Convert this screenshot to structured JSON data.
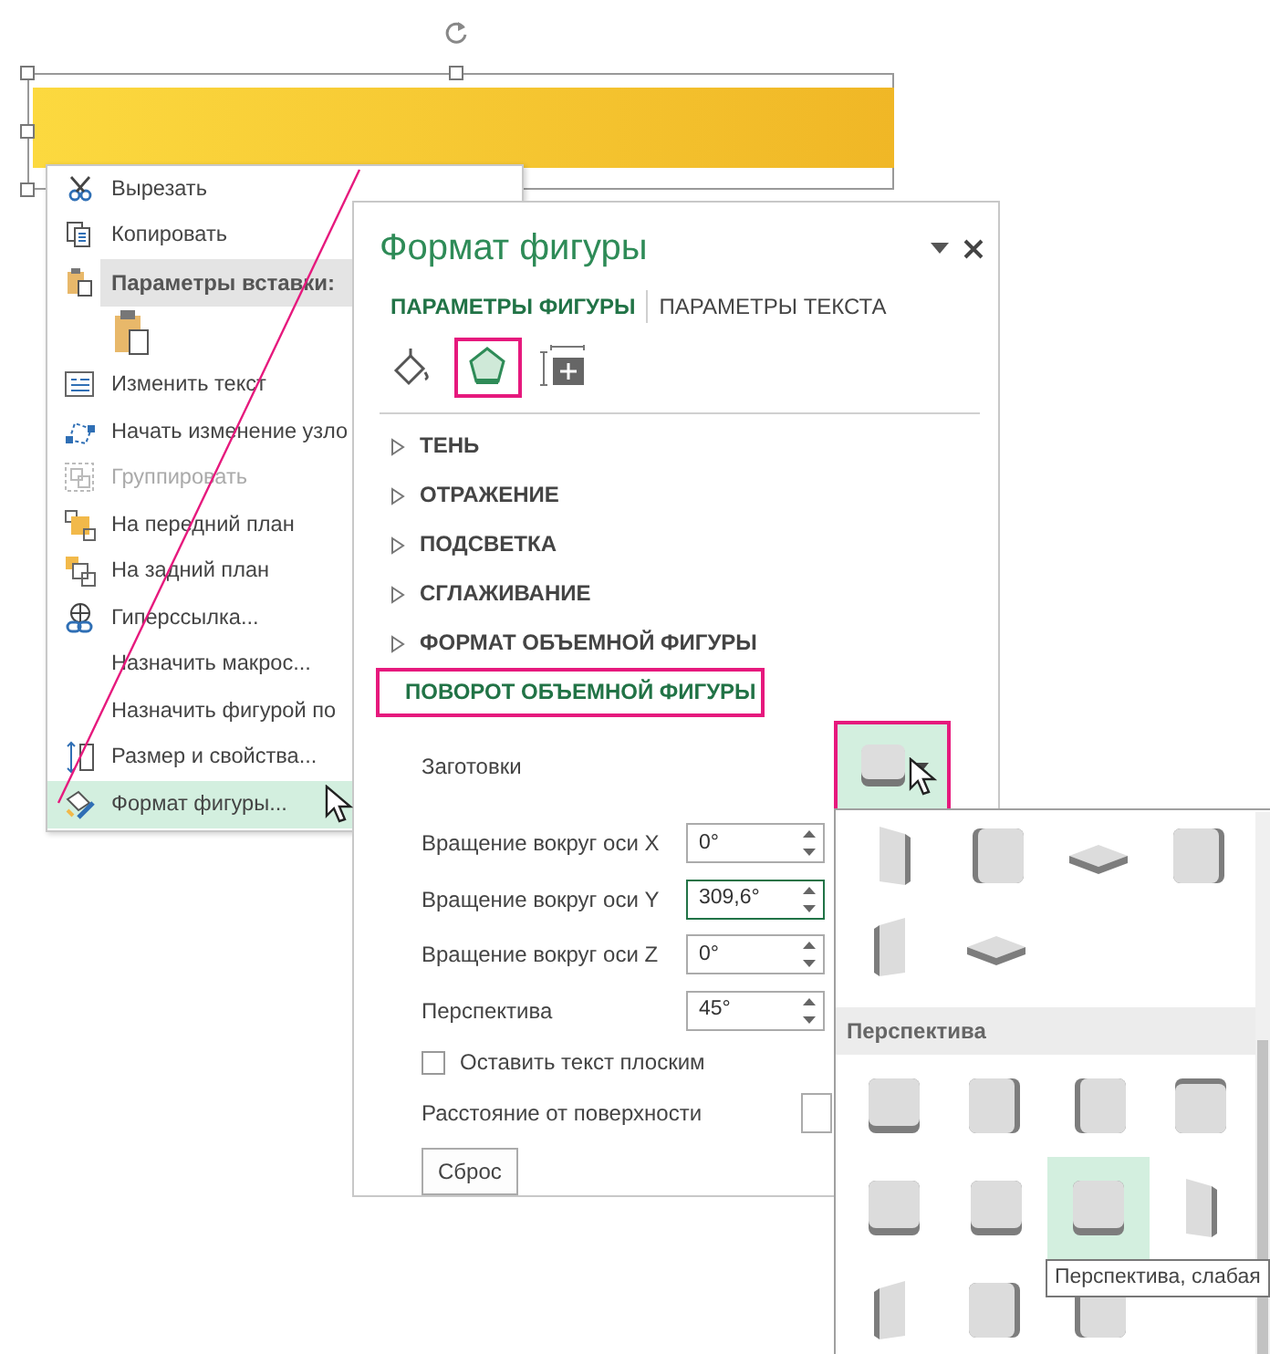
{
  "context_menu": {
    "items": [
      {
        "kind": "item",
        "label": "Вырезать",
        "disabled": false,
        "selected": false
      },
      {
        "kind": "item",
        "label": "Копировать",
        "disabled": false,
        "selected": false
      },
      {
        "kind": "header",
        "label": "Параметры вставки:",
        "disabled": false,
        "selected": false
      },
      {
        "kind": "paste-options",
        "disabled": false,
        "selected": false
      },
      {
        "kind": "item",
        "label": "Изменить текст",
        "disabled": false,
        "selected": false
      },
      {
        "kind": "item",
        "label": "Начать изменение узло",
        "disabled": false,
        "selected": false
      },
      {
        "kind": "item",
        "label": "Группировать",
        "disabled": true,
        "selected": false
      },
      {
        "kind": "item",
        "label": "На передний план",
        "disabled": false,
        "selected": false
      },
      {
        "kind": "item",
        "label": "На задний план",
        "disabled": false,
        "selected": false
      },
      {
        "kind": "item",
        "label": "Гиперссылка...",
        "disabled": false,
        "selected": false
      },
      {
        "kind": "item",
        "label": "Назначить макрос...",
        "disabled": false,
        "selected": false
      },
      {
        "kind": "item",
        "label": "Назначить фигурой по",
        "disabled": false,
        "selected": false
      },
      {
        "kind": "item",
        "label": "Размер и свойства...",
        "disabled": false,
        "selected": false
      },
      {
        "kind": "item",
        "label": "Формат фигуры...",
        "disabled": false,
        "selected": true
      }
    ]
  },
  "format_panel": {
    "title": "Формат фигуры",
    "text_tabs": [
      {
        "label": "ПАРАМЕТРЫ ФИГУРЫ",
        "selected": true
      },
      {
        "label": "ПАРАМЕТРЫ ТЕКСТА",
        "selected": false
      }
    ],
    "icon_tabs": [
      {
        "selected": false,
        "highlighted": false
      },
      {
        "selected": true,
        "highlighted": true
      },
      {
        "selected": false,
        "highlighted": false
      }
    ],
    "sections": [
      {
        "label": "ТЕНЬ",
        "expanded": false,
        "highlighted": false
      },
      {
        "label": "ОТРАЖЕНИЕ",
        "expanded": false,
        "highlighted": false
      },
      {
        "label": "ПОДСВЕТКА",
        "expanded": false,
        "highlighted": false
      },
      {
        "label": "СГЛАЖИВАНИЕ",
        "expanded": false,
        "highlighted": false
      },
      {
        "label": "ФОРМАТ ОБЪЕМНОЙ ФИГУРЫ",
        "expanded": false,
        "highlighted": false
      },
      {
        "label": "ПОВОРОТ ОБЪЕМНОЙ ФИГУРЫ",
        "expanded": true,
        "highlighted": true
      }
    ],
    "presets": {
      "label": "Заготовки",
      "highlighted": true
    },
    "fields": [
      {
        "label": "Вращение вокруг оси X",
        "value": "0°",
        "focused": false
      },
      {
        "label": "Вращение вокруг оси Y",
        "value": "309,6°",
        "focused": true
      },
      {
        "label": "Вращение вокруг оси Z",
        "value": "0°",
        "focused": false
      },
      {
        "label": "Перспектива",
        "value": "45°",
        "focused": false
      }
    ],
    "checkbox": {
      "label": "Оставить текст плоским",
      "checked": false
    },
    "distance": {
      "label": "Расстояние от поверхности"
    },
    "reset_button": "Сброс"
  },
  "gallery": {
    "groups": [
      {
        "items": [
          {
            "kind": "right-tilt",
            "selected": false
          },
          {
            "kind": "left",
            "selected": false
          },
          {
            "kind": "flat",
            "selected": false
          },
          {
            "kind": "right",
            "selected": false
          },
          {
            "kind": "left-tilt",
            "selected": false
          },
          {
            "kind": "flat",
            "selected": false
          }
        ]
      },
      {
        "header": "Перспектива",
        "items": [
          {
            "kind": "bottom",
            "selected": false
          },
          {
            "kind": "right",
            "selected": false
          },
          {
            "kind": "left",
            "selected": false
          },
          {
            "kind": "top",
            "selected": false
          },
          {
            "kind": "bottom",
            "selected": false
          },
          {
            "kind": "bottom",
            "selected": false
          },
          {
            "kind": "bottom",
            "selected": true
          },
          {
            "kind": "right-tilt",
            "selected": false
          },
          {
            "kind": "left-tilt",
            "selected": false
          },
          {
            "kind": "right",
            "selected": false
          },
          {
            "kind": "left",
            "selected": false
          }
        ]
      }
    ]
  },
  "tooltip": "Перспектива, слабая"
}
